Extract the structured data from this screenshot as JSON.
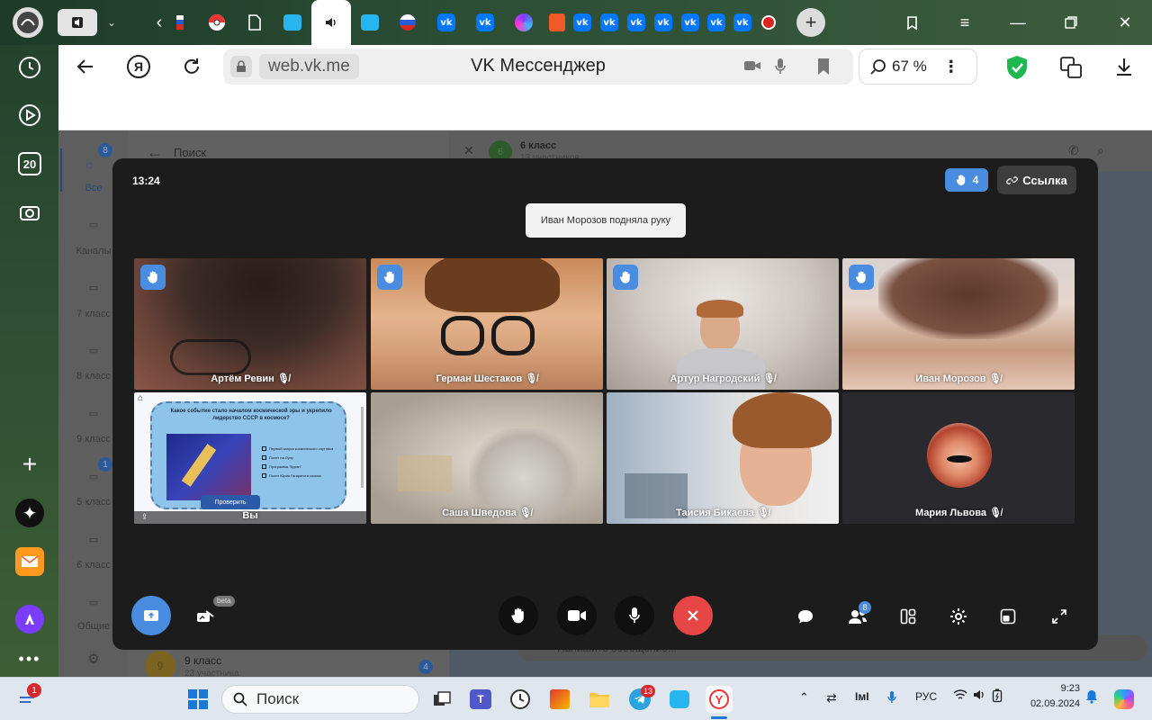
{
  "browser": {
    "url_host": "web.vk.me",
    "page_title": "VK Мессенджер",
    "zoom": "67 %",
    "sidebar_badge": "20"
  },
  "vk_app": {
    "rail": {
      "all_badge": "8",
      "all_label": "Все",
      "folders": [
        "Каналы",
        "7 класс",
        "8 класс",
        "9 класс",
        "5 класс",
        "6 класс",
        "Общие"
      ],
      "folder_5_badge": "1"
    },
    "list": {
      "search_label": "Поиск",
      "bottom_chat": {
        "name": "9 класс",
        "subtitle": "23 участника",
        "avatar_letter": "9",
        "badge": "4"
      }
    },
    "chat": {
      "title": "6 класс",
      "subtitle": "13 участников",
      "avatar_letter": "6",
      "composer_placeholder": "Напишите сообщение..."
    }
  },
  "call": {
    "time": "13:24",
    "raised_hands": "4",
    "link_label": "Ссылка",
    "toast": "Иван Морозов подняла руку",
    "beta_label": "beta",
    "participants_badge": "8",
    "participants": [
      {
        "name": "Артём Ревин",
        "hand": true,
        "muted": true
      },
      {
        "name": "Герман Шестаков",
        "hand": true,
        "muted": true
      },
      {
        "name": "Артур Нагродский",
        "hand": true,
        "muted": true
      },
      {
        "name": "Иван Морозов",
        "hand": true,
        "muted": true
      },
      {
        "name": "Вы",
        "hand": false,
        "muted": false
      },
      {
        "name": "Саша Шведова",
        "hand": false,
        "muted": true
      },
      {
        "name": "Таисия Бикаева",
        "hand": false,
        "muted": true
      },
      {
        "name": "Мария Львова",
        "hand": false,
        "muted": true
      }
    ],
    "screen_share": {
      "question": "Какое событие стало началом космической эры и укрепило лидерство СССР в космосе?",
      "options": [
        "Первый запуск космического спутника",
        "Полет на Луну",
        "Программа \"Буран\"",
        "Полет Юрия Гагарина в космос"
      ],
      "check_button": "Проверить"
    }
  },
  "taskbar": {
    "search_label": "Поиск",
    "notification_badge": "1",
    "telegram_badge": "13",
    "language": "РУС",
    "time": "9:23",
    "date": "02.09.2024"
  },
  "colors": {
    "accent_blue": "#4a8de0",
    "hangup_red": "#e64646",
    "vk_blue": "#0077ff",
    "call_bg": "#1c1c1c"
  }
}
